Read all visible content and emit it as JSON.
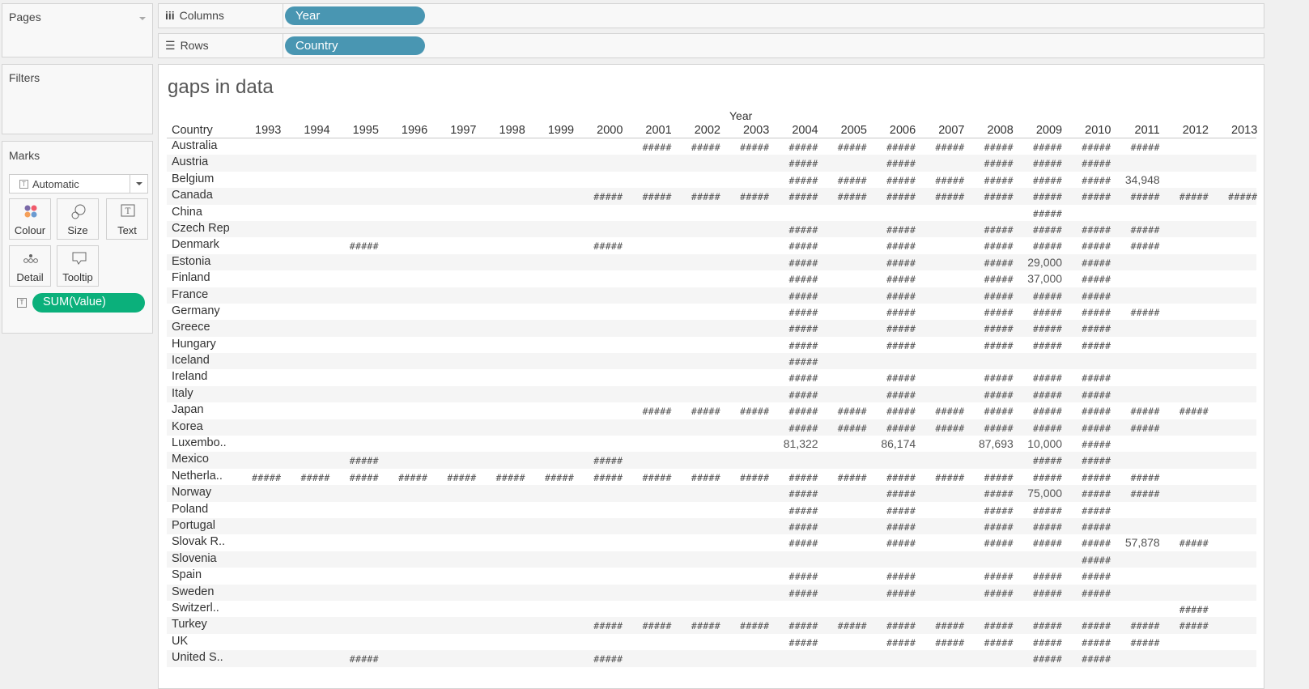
{
  "pages": {
    "title": "Pages"
  },
  "filters": {
    "title": "Filters"
  },
  "marks": {
    "title": "Marks",
    "type": "Automatic",
    "buttons": {
      "colour": "Colour",
      "size": "Size",
      "text": "Text",
      "detail": "Detail",
      "tooltip": "Tooltip"
    },
    "pill": "SUM(Value)",
    "pill_color": "#0bb07b"
  },
  "columns": {
    "label": "Columns",
    "pill": "Year"
  },
  "rows": {
    "label": "Rows",
    "pill": "Country"
  },
  "pill_color": "#4996b2",
  "view": {
    "title": "gaps in data",
    "column_header": "Year",
    "row_header": "Country"
  },
  "years": [
    "1993",
    "1994",
    "1995",
    "1996",
    "1997",
    "1998",
    "1999",
    "2000",
    "2001",
    "2002",
    "2003",
    "2004",
    "2005",
    "2006",
    "2007",
    "2008",
    "2009",
    "2010",
    "2011",
    "2012",
    "2013"
  ],
  "table": [
    {
      "country": "Australia",
      "cells": [
        "",
        "",
        "",
        "",
        "",
        "",
        "",
        "",
        "#####",
        "#####",
        "#####",
        "#####",
        "#####",
        "#####",
        "#####",
        "#####",
        "#####",
        "#####",
        "#####",
        "",
        ""
      ]
    },
    {
      "country": "Austria",
      "cells": [
        "",
        "",
        "",
        "",
        "",
        "",
        "",
        "",
        "",
        "",
        "",
        "#####",
        "",
        "#####",
        "",
        "#####",
        "#####",
        "#####",
        "",
        "",
        ""
      ]
    },
    {
      "country": "Belgium",
      "cells": [
        "",
        "",
        "",
        "",
        "",
        "",
        "",
        "",
        "",
        "",
        "",
        "#####",
        "#####",
        "#####",
        "#####",
        "#####",
        "#####",
        "#####",
        "34,948",
        "",
        ""
      ]
    },
    {
      "country": "Canada",
      "cells": [
        "",
        "",
        "",
        "",
        "",
        "",
        "",
        "#####",
        "#####",
        "#####",
        "#####",
        "#####",
        "#####",
        "#####",
        "#####",
        "#####",
        "#####",
        "#####",
        "#####",
        "#####",
        "#####"
      ]
    },
    {
      "country": "China",
      "cells": [
        "",
        "",
        "",
        "",
        "",
        "",
        "",
        "",
        "",
        "",
        "",
        "",
        "",
        "",
        "",
        "",
        "#####",
        "",
        "",
        "",
        ""
      ]
    },
    {
      "country": "Czech Rep",
      "cells": [
        "",
        "",
        "",
        "",
        "",
        "",
        "",
        "",
        "",
        "",
        "",
        "#####",
        "",
        "#####",
        "",
        "#####",
        "#####",
        "#####",
        "#####",
        "",
        ""
      ]
    },
    {
      "country": "Denmark",
      "cells": [
        "",
        "",
        "#####",
        "",
        "",
        "",
        "",
        "#####",
        "",
        "",
        "",
        "#####",
        "",
        "#####",
        "",
        "#####",
        "#####",
        "#####",
        "#####",
        "",
        ""
      ]
    },
    {
      "country": "Estonia",
      "cells": [
        "",
        "",
        "",
        "",
        "",
        "",
        "",
        "",
        "",
        "",
        "",
        "#####",
        "",
        "#####",
        "",
        "#####",
        "29,000",
        "#####",
        "",
        "",
        ""
      ]
    },
    {
      "country": "Finland",
      "cells": [
        "",
        "",
        "",
        "",
        "",
        "",
        "",
        "",
        "",
        "",
        "",
        "#####",
        "",
        "#####",
        "",
        "#####",
        "37,000",
        "#####",
        "",
        "",
        ""
      ]
    },
    {
      "country": "France",
      "cells": [
        "",
        "",
        "",
        "",
        "",
        "",
        "",
        "",
        "",
        "",
        "",
        "#####",
        "",
        "#####",
        "",
        "#####",
        "#####",
        "#####",
        "",
        "",
        ""
      ]
    },
    {
      "country": "Germany",
      "cells": [
        "",
        "",
        "",
        "",
        "",
        "",
        "",
        "",
        "",
        "",
        "",
        "#####",
        "",
        "#####",
        "",
        "#####",
        "#####",
        "#####",
        "#####",
        "",
        ""
      ]
    },
    {
      "country": "Greece",
      "cells": [
        "",
        "",
        "",
        "",
        "",
        "",
        "",
        "",
        "",
        "",
        "",
        "#####",
        "",
        "#####",
        "",
        "#####",
        "#####",
        "#####",
        "",
        "",
        ""
      ]
    },
    {
      "country": "Hungary",
      "cells": [
        "",
        "",
        "",
        "",
        "",
        "",
        "",
        "",
        "",
        "",
        "",
        "#####",
        "",
        "#####",
        "",
        "#####",
        "#####",
        "#####",
        "",
        "",
        ""
      ]
    },
    {
      "country": "Iceland",
      "cells": [
        "",
        "",
        "",
        "",
        "",
        "",
        "",
        "",
        "",
        "",
        "",
        "#####",
        "",
        "",
        "",
        "",
        "",
        "",
        "",
        "",
        ""
      ]
    },
    {
      "country": "Ireland",
      "cells": [
        "",
        "",
        "",
        "",
        "",
        "",
        "",
        "",
        "",
        "",
        "",
        "#####",
        "",
        "#####",
        "",
        "#####",
        "#####",
        "#####",
        "",
        "",
        ""
      ]
    },
    {
      "country": "Italy",
      "cells": [
        "",
        "",
        "",
        "",
        "",
        "",
        "",
        "",
        "",
        "",
        "",
        "#####",
        "",
        "#####",
        "",
        "#####",
        "#####",
        "#####",
        "",
        "",
        ""
      ]
    },
    {
      "country": "Japan",
      "cells": [
        "",
        "",
        "",
        "",
        "",
        "",
        "",
        "",
        "#####",
        "#####",
        "#####",
        "#####",
        "#####",
        "#####",
        "#####",
        "#####",
        "#####",
        "#####",
        "#####",
        "#####",
        ""
      ]
    },
    {
      "country": "Korea",
      "cells": [
        "",
        "",
        "",
        "",
        "",
        "",
        "",
        "",
        "",
        "",
        "",
        "#####",
        "#####",
        "#####",
        "#####",
        "#####",
        "#####",
        "#####",
        "#####",
        "",
        ""
      ]
    },
    {
      "country": "Luxembo..",
      "cells": [
        "",
        "",
        "",
        "",
        "",
        "",
        "",
        "",
        "",
        "",
        "",
        "81,322",
        "",
        "86,174",
        "",
        "87,693",
        "10,000",
        "#####",
        "",
        "",
        ""
      ]
    },
    {
      "country": "Mexico",
      "cells": [
        "",
        "",
        "#####",
        "",
        "",
        "",
        "",
        "#####",
        "",
        "",
        "",
        "",
        "",
        "",
        "",
        "",
        "#####",
        "#####",
        "",
        "",
        ""
      ]
    },
    {
      "country": "Netherla..",
      "cells": [
        "#####",
        "#####",
        "#####",
        "#####",
        "#####",
        "#####",
        "#####",
        "#####",
        "#####",
        "#####",
        "#####",
        "#####",
        "#####",
        "#####",
        "#####",
        "#####",
        "#####",
        "#####",
        "#####",
        "",
        ""
      ]
    },
    {
      "country": "Norway",
      "cells": [
        "",
        "",
        "",
        "",
        "",
        "",
        "",
        "",
        "",
        "",
        "",
        "#####",
        "",
        "#####",
        "",
        "#####",
        "75,000",
        "#####",
        "#####",
        "",
        ""
      ]
    },
    {
      "country": "Poland",
      "cells": [
        "",
        "",
        "",
        "",
        "",
        "",
        "",
        "",
        "",
        "",
        "",
        "#####",
        "",
        "#####",
        "",
        "#####",
        "#####",
        "#####",
        "",
        "",
        ""
      ]
    },
    {
      "country": "Portugal",
      "cells": [
        "",
        "",
        "",
        "",
        "",
        "",
        "",
        "",
        "",
        "",
        "",
        "#####",
        "",
        "#####",
        "",
        "#####",
        "#####",
        "#####",
        "",
        "",
        ""
      ]
    },
    {
      "country": "Slovak R..",
      "cells": [
        "",
        "",
        "",
        "",
        "",
        "",
        "",
        "",
        "",
        "",
        "",
        "#####",
        "",
        "#####",
        "",
        "#####",
        "#####",
        "#####",
        "57,878",
        "#####",
        ""
      ]
    },
    {
      "country": "Slovenia",
      "cells": [
        "",
        "",
        "",
        "",
        "",
        "",
        "",
        "",
        "",
        "",
        "",
        "",
        "",
        "",
        "",
        "",
        "",
        "#####",
        "",
        "",
        ""
      ]
    },
    {
      "country": "Spain",
      "cells": [
        "",
        "",
        "",
        "",
        "",
        "",
        "",
        "",
        "",
        "",
        "",
        "#####",
        "",
        "#####",
        "",
        "#####",
        "#####",
        "#####",
        "",
        "",
        ""
      ]
    },
    {
      "country": "Sweden",
      "cells": [
        "",
        "",
        "",
        "",
        "",
        "",
        "",
        "",
        "",
        "",
        "",
        "#####",
        "",
        "#####",
        "",
        "#####",
        "#####",
        "#####",
        "",
        "",
        ""
      ]
    },
    {
      "country": "Switzerl..",
      "cells": [
        "",
        "",
        "",
        "",
        "",
        "",
        "",
        "",
        "",
        "",
        "",
        "",
        "",
        "",
        "",
        "",
        "",
        "",
        "",
        "#####",
        ""
      ]
    },
    {
      "country": "Turkey",
      "cells": [
        "",
        "",
        "",
        "",
        "",
        "",
        "",
        "#####",
        "#####",
        "#####",
        "#####",
        "#####",
        "#####",
        "#####",
        "#####",
        "#####",
        "#####",
        "#####",
        "#####",
        "#####",
        ""
      ]
    },
    {
      "country": "UK",
      "cells": [
        "",
        "",
        "",
        "",
        "",
        "",
        "",
        "",
        "",
        "",
        "",
        "#####",
        "",
        "#####",
        "#####",
        "#####",
        "#####",
        "#####",
        "#####",
        "",
        ""
      ]
    },
    {
      "country": "United S..",
      "cells": [
        "",
        "",
        "#####",
        "",
        "",
        "",
        "",
        "#####",
        "",
        "",
        "",
        "",
        "",
        "",
        "",
        "",
        "#####",
        "#####",
        "",
        "",
        ""
      ]
    }
  ]
}
